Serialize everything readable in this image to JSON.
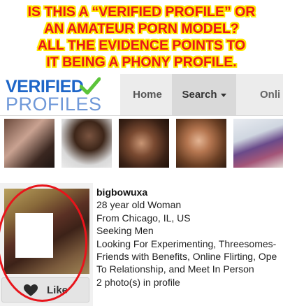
{
  "banner": {
    "lines": [
      "IS THIS A “VERIFIED PROFILE” OR",
      "AN AMATEUR PORN MODEL?",
      "ALL THE EVIDENCE POINTS TO",
      "IT BEING A PHONY PROFILE."
    ],
    "text_color": "#e8141b",
    "outline_color": "#ffe800"
  },
  "logo": {
    "top_text": "VERIFIED",
    "bottom_text": "PROFILES",
    "icon": "checkmark-icon",
    "colors": {
      "top": "#1e66c8",
      "bottom": "#6f98d8",
      "check": "#5bc43a"
    }
  },
  "nav": {
    "items": [
      "Home",
      "Search",
      "Onli"
    ],
    "active": "Search"
  },
  "photo_strip": {
    "count": 5
  },
  "profile": {
    "username": "bigbowuxa",
    "lines": [
      "28 year old Woman",
      "From Chicago, IL, US",
      "Seeking Men",
      "Looking For Experimenting, Threesomes-",
      "Friends with Benefits, Online Flirting, Ope",
      "To Relationship, and Meet In Person",
      "2 photo(s) in profile"
    ],
    "like_label": "Like",
    "like_icon": "heart-icon",
    "annotation_color": "#e8141b"
  }
}
